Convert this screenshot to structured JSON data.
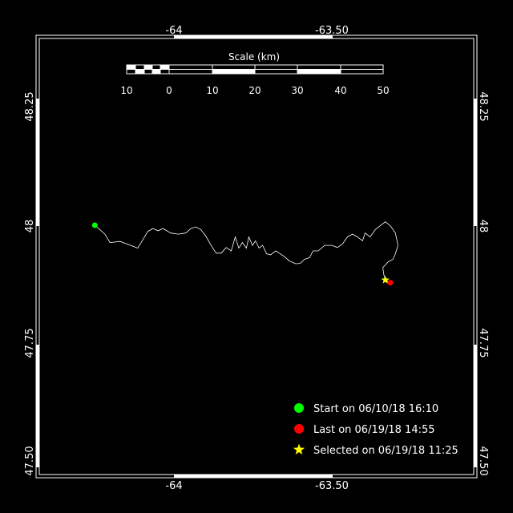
{
  "map": {
    "lon_ticks": [
      "-64",
      "-63.50"
    ],
    "lat_ticks": [
      "48.25",
      "48",
      "47.75",
      "47.50"
    ],
    "lon_range": [
      -64.18,
      -63.32
    ],
    "lat_range": [
      47.5,
      48.28
    ],
    "colors": {
      "background": "#000000",
      "frame": "#ffffff",
      "track": "#ffffff",
      "start": "#00ff00",
      "last": "#ff0000",
      "selected": "#ffff00"
    }
  },
  "scale_bar": {
    "title": "Scale (km)",
    "labels": [
      "10",
      "0",
      "10",
      "20",
      "30",
      "40",
      "50"
    ]
  },
  "legend": {
    "items": [
      {
        "symbol": "green-dot-icon",
        "label": "Start on 06/10/18 16:10"
      },
      {
        "symbol": "red-dot-icon",
        "label": "Last on 06/19/18 14:55"
      },
      {
        "symbol": "yellow-star-icon",
        "label": "Selected on 06/19/18 11:25"
      }
    ]
  },
  "track": {
    "start": {
      "lon": -64.07,
      "lat": 47.946
    },
    "last": {
      "lon": -63.485,
      "lat": 47.843
    },
    "selected": {
      "lon": -63.495,
      "lat": 47.848
    },
    "points": [
      [
        -64.07,
        47.946
      ],
      [
        -64.05,
        47.93
      ],
      [
        -64.04,
        47.915
      ],
      [
        -64.02,
        47.917
      ],
      [
        -64.005,
        47.912
      ],
      [
        -63.985,
        47.905
      ],
      [
        -63.975,
        47.92
      ],
      [
        -63.965,
        47.935
      ],
      [
        -63.955,
        47.94
      ],
      [
        -63.945,
        47.936
      ],
      [
        -63.935,
        47.94
      ],
      [
        -63.92,
        47.932
      ],
      [
        -63.905,
        47.93
      ],
      [
        -63.89,
        47.932
      ],
      [
        -63.88,
        47.94
      ],
      [
        -63.87,
        47.943
      ],
      [
        -63.86,
        47.938
      ],
      [
        -63.85,
        47.926
      ],
      [
        -63.84,
        47.91
      ],
      [
        -63.83,
        47.896
      ],
      [
        -63.82,
        47.896
      ],
      [
        -63.81,
        47.906
      ],
      [
        -63.8,
        47.9
      ],
      [
        -63.792,
        47.925
      ],
      [
        -63.785,
        47.905
      ],
      [
        -63.778,
        47.915
      ],
      [
        -63.77,
        47.905
      ],
      [
        -63.765,
        47.925
      ],
      [
        -63.758,
        47.91
      ],
      [
        -63.752,
        47.918
      ],
      [
        -63.745,
        47.905
      ],
      [
        -63.738,
        47.91
      ],
      [
        -63.73,
        47.895
      ],
      [
        -63.722,
        47.893
      ],
      [
        -63.712,
        47.9
      ],
      [
        -63.705,
        47.896
      ],
      [
        -63.695,
        47.89
      ],
      [
        -63.685,
        47.882
      ],
      [
        -63.672,
        47.877
      ],
      [
        -63.663,
        47.878
      ],
      [
        -63.655,
        47.885
      ],
      [
        -63.645,
        47.888
      ],
      [
        -63.638,
        47.9
      ],
      [
        -63.628,
        47.9
      ],
      [
        -63.615,
        47.91
      ],
      [
        -63.6,
        47.91
      ],
      [
        -63.59,
        47.906
      ],
      [
        -63.58,
        47.912
      ],
      [
        -63.57,
        47.925
      ],
      [
        -63.56,
        47.93
      ],
      [
        -63.55,
        47.925
      ],
      [
        -63.54,
        47.918
      ],
      [
        -63.535,
        47.932
      ],
      [
        -63.525,
        47.925
      ],
      [
        -63.515,
        47.938
      ],
      [
        -63.505,
        47.945
      ],
      [
        -63.495,
        47.952
      ],
      [
        -63.485,
        47.945
      ],
      [
        -63.475,
        47.932
      ],
      [
        -63.47,
        47.91
      ],
      [
        -63.475,
        47.895
      ],
      [
        -63.48,
        47.885
      ],
      [
        -63.49,
        47.88
      ],
      [
        -63.5,
        47.87
      ],
      [
        -63.498,
        47.858
      ],
      [
        -63.495,
        47.848
      ],
      [
        -63.485,
        47.843
      ]
    ]
  }
}
